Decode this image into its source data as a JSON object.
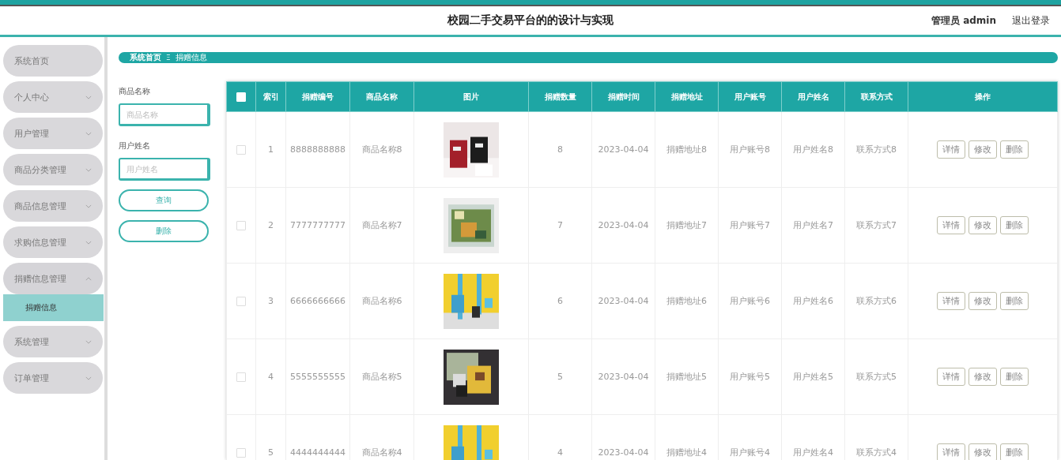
{
  "header": {
    "title": "校园二手交易平台的的设计与实现",
    "user": "管理员 admin",
    "logout": "退出登录"
  },
  "sidebar": {
    "items": [
      {
        "label": "系统首页",
        "kind": "link"
      },
      {
        "label": "个人中心",
        "kind": "menu",
        "expanded": false
      },
      {
        "label": "用户管理",
        "kind": "menu",
        "expanded": false
      },
      {
        "label": "商品分类管理",
        "kind": "menu",
        "expanded": false
      },
      {
        "label": "商品信息管理",
        "kind": "menu",
        "expanded": false
      },
      {
        "label": "求购信息管理",
        "kind": "menu",
        "expanded": false
      },
      {
        "label": "捐赠信息管理",
        "kind": "menu",
        "expanded": true,
        "children": [
          {
            "label": "捐赠信息",
            "selected": true
          }
        ]
      },
      {
        "label": "系统管理",
        "kind": "menu",
        "expanded": false
      },
      {
        "label": "订单管理",
        "kind": "menu",
        "expanded": false
      }
    ]
  },
  "breadcrumb": {
    "items": [
      "系统首页",
      "捐赠信息"
    ],
    "separator": "Ξ"
  },
  "search": {
    "fields": [
      {
        "label": "商品名称",
        "placeholder": "商品名称"
      },
      {
        "label": "用户姓名",
        "placeholder": "用户姓名"
      }
    ],
    "buttons": [
      "查询",
      "删除"
    ]
  },
  "table": {
    "select_all": {
      "checked": false
    },
    "columns": [
      "索引",
      "捐赠编号",
      "商品名称",
      "图片",
      "捐赠数量",
      "捐赠时间",
      "捐赠地址",
      "用户账号",
      "用户姓名",
      "联系方式",
      "操作"
    ],
    "rows": [
      {
        "checked": false,
        "cells": [
          "1",
          "8888888888",
          "商品名称8",
          {
            "kind": "picture"
          },
          "8",
          "2023-04-04",
          "捐赠地址8",
          "用户账号8",
          "用户姓名8",
          "联系方式8"
        ],
        "actions": [
          "详情",
          "修改",
          "删除"
        ]
      },
      {
        "checked": false,
        "cells": [
          "2",
          "7777777777",
          "商品名称7",
          {
            "kind": "picture"
          },
          "7",
          "2023-04-04",
          "捐赠地址7",
          "用户账号7",
          "用户姓名7",
          "联系方式7"
        ],
        "actions": [
          "详情",
          "修改",
          "删除"
        ]
      },
      {
        "checked": false,
        "cells": [
          "3",
          "6666666666",
          "商品名称6",
          {
            "kind": "picture"
          },
          "6",
          "2023-04-04",
          "捐赠地址6",
          "用户账号6",
          "用户姓名6",
          "联系方式6"
        ],
        "actions": [
          "详情",
          "修改",
          "删除"
        ]
      },
      {
        "checked": false,
        "cells": [
          "4",
          "5555555555",
          "商品名称5",
          {
            "kind": "picture"
          },
          "5",
          "2023-04-04",
          "捐赠地址5",
          "用户账号5",
          "用户姓名5",
          "联系方式5"
        ],
        "actions": [
          "详情",
          "修改",
          "删除"
        ]
      },
      {
        "checked": false,
        "cells": [
          "5",
          "4444444444",
          "商品名称4",
          {
            "kind": "picture"
          },
          "4",
          "2023-04-04",
          "捐赠地址4",
          "用户账号4",
          "用户姓名4",
          "联系方式4"
        ],
        "actions": [
          "详情",
          "修改",
          "删除"
        ]
      }
    ]
  }
}
